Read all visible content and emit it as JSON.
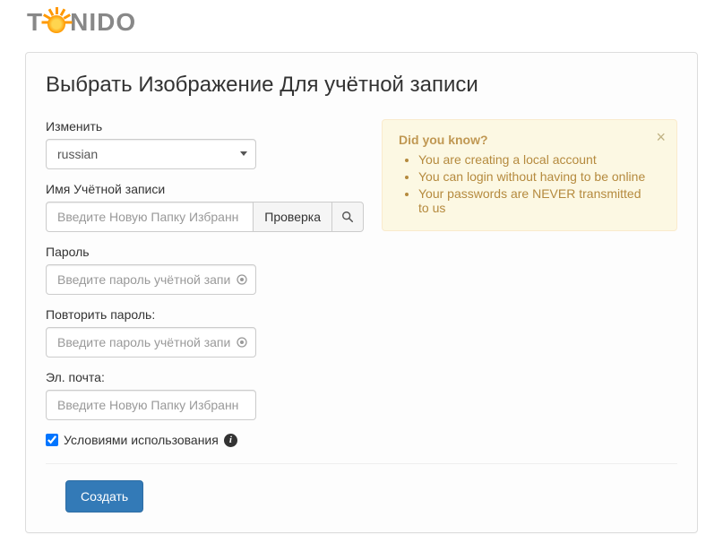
{
  "logo": {
    "t": "T",
    "rest": "NIDO"
  },
  "page_title": "Выбрать Изображение Для учётной записи",
  "form": {
    "language_label": "Изменить",
    "language_value": "russian",
    "account_label": "Имя Учётной записи",
    "account_placeholder": "Введите Новую Папку Избранн",
    "check_btn": "Проверка",
    "password_label": "Пароль",
    "password_placeholder": "Введите пароль учётной запи",
    "repeat_password_label": "Повторить пароль:",
    "repeat_password_placeholder": "Введите пароль учётной запи",
    "email_label": "Эл. почта:",
    "email_placeholder": "Введите Новую Папку Избранн",
    "terms_label": "Условиями использования",
    "submit": "Создать"
  },
  "info": {
    "title": "Did you know?",
    "items": [
      "You are creating a local account",
      "You can login without having to be online",
      "Your passwords are NEVER transmitted to us"
    ]
  }
}
